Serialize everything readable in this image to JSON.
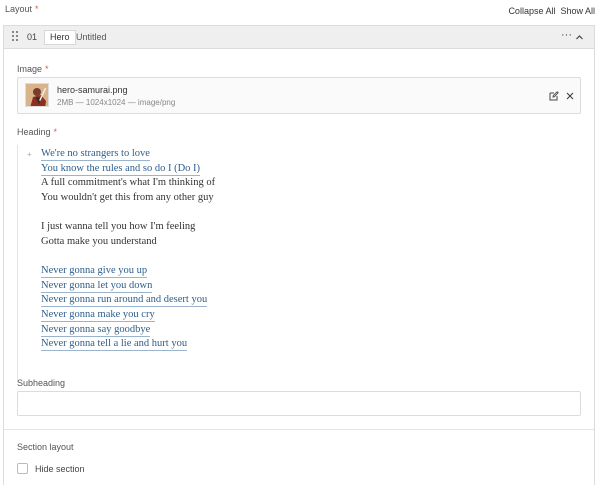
{
  "layout": {
    "label": "Layout",
    "required_mark": "*"
  },
  "top_actions": {
    "collapse_all": "Collapse All",
    "show_all": "Show All"
  },
  "block": {
    "index": "01",
    "type_badge": "Hero",
    "title": "Untitled",
    "more_label": "···",
    "image": {
      "label": "Image",
      "required_mark": "*",
      "file_name": "hero-samurai.png",
      "file_meta": "2MB — 1024x1024 — image/png"
    },
    "heading": {
      "label": "Heading",
      "required_mark": "*",
      "bullet": "+",
      "lines": [
        "We're no strangers to love",
        "You know the rules and so do I (Do I)",
        "A full commitment's what I'm thinking of",
        "You wouldn't get this from any other guy",
        "I just wanna tell you how I'm feeling",
        "Gotta make you understand",
        "Never gonna give you up",
        "Never gonna let you down",
        "Never gonna run around and desert you",
        "Never gonna make you cry",
        "Never gonna say goodbye",
        "Never gonna tell a lie and hurt you"
      ]
    },
    "subheading": {
      "label": "Subheading",
      "value": ""
    },
    "section_layout": {
      "label": "Section layout",
      "hide_section_label": "Hide section",
      "hide_section_checked": false
    }
  },
  "colors": {
    "required": "#e05a4a",
    "link": "#2e5e8c",
    "header_bg": "#efefef"
  },
  "icons": [
    "drag-handle-icon",
    "more-icon",
    "chevron-up-icon",
    "edit-icon",
    "close-icon"
  ]
}
